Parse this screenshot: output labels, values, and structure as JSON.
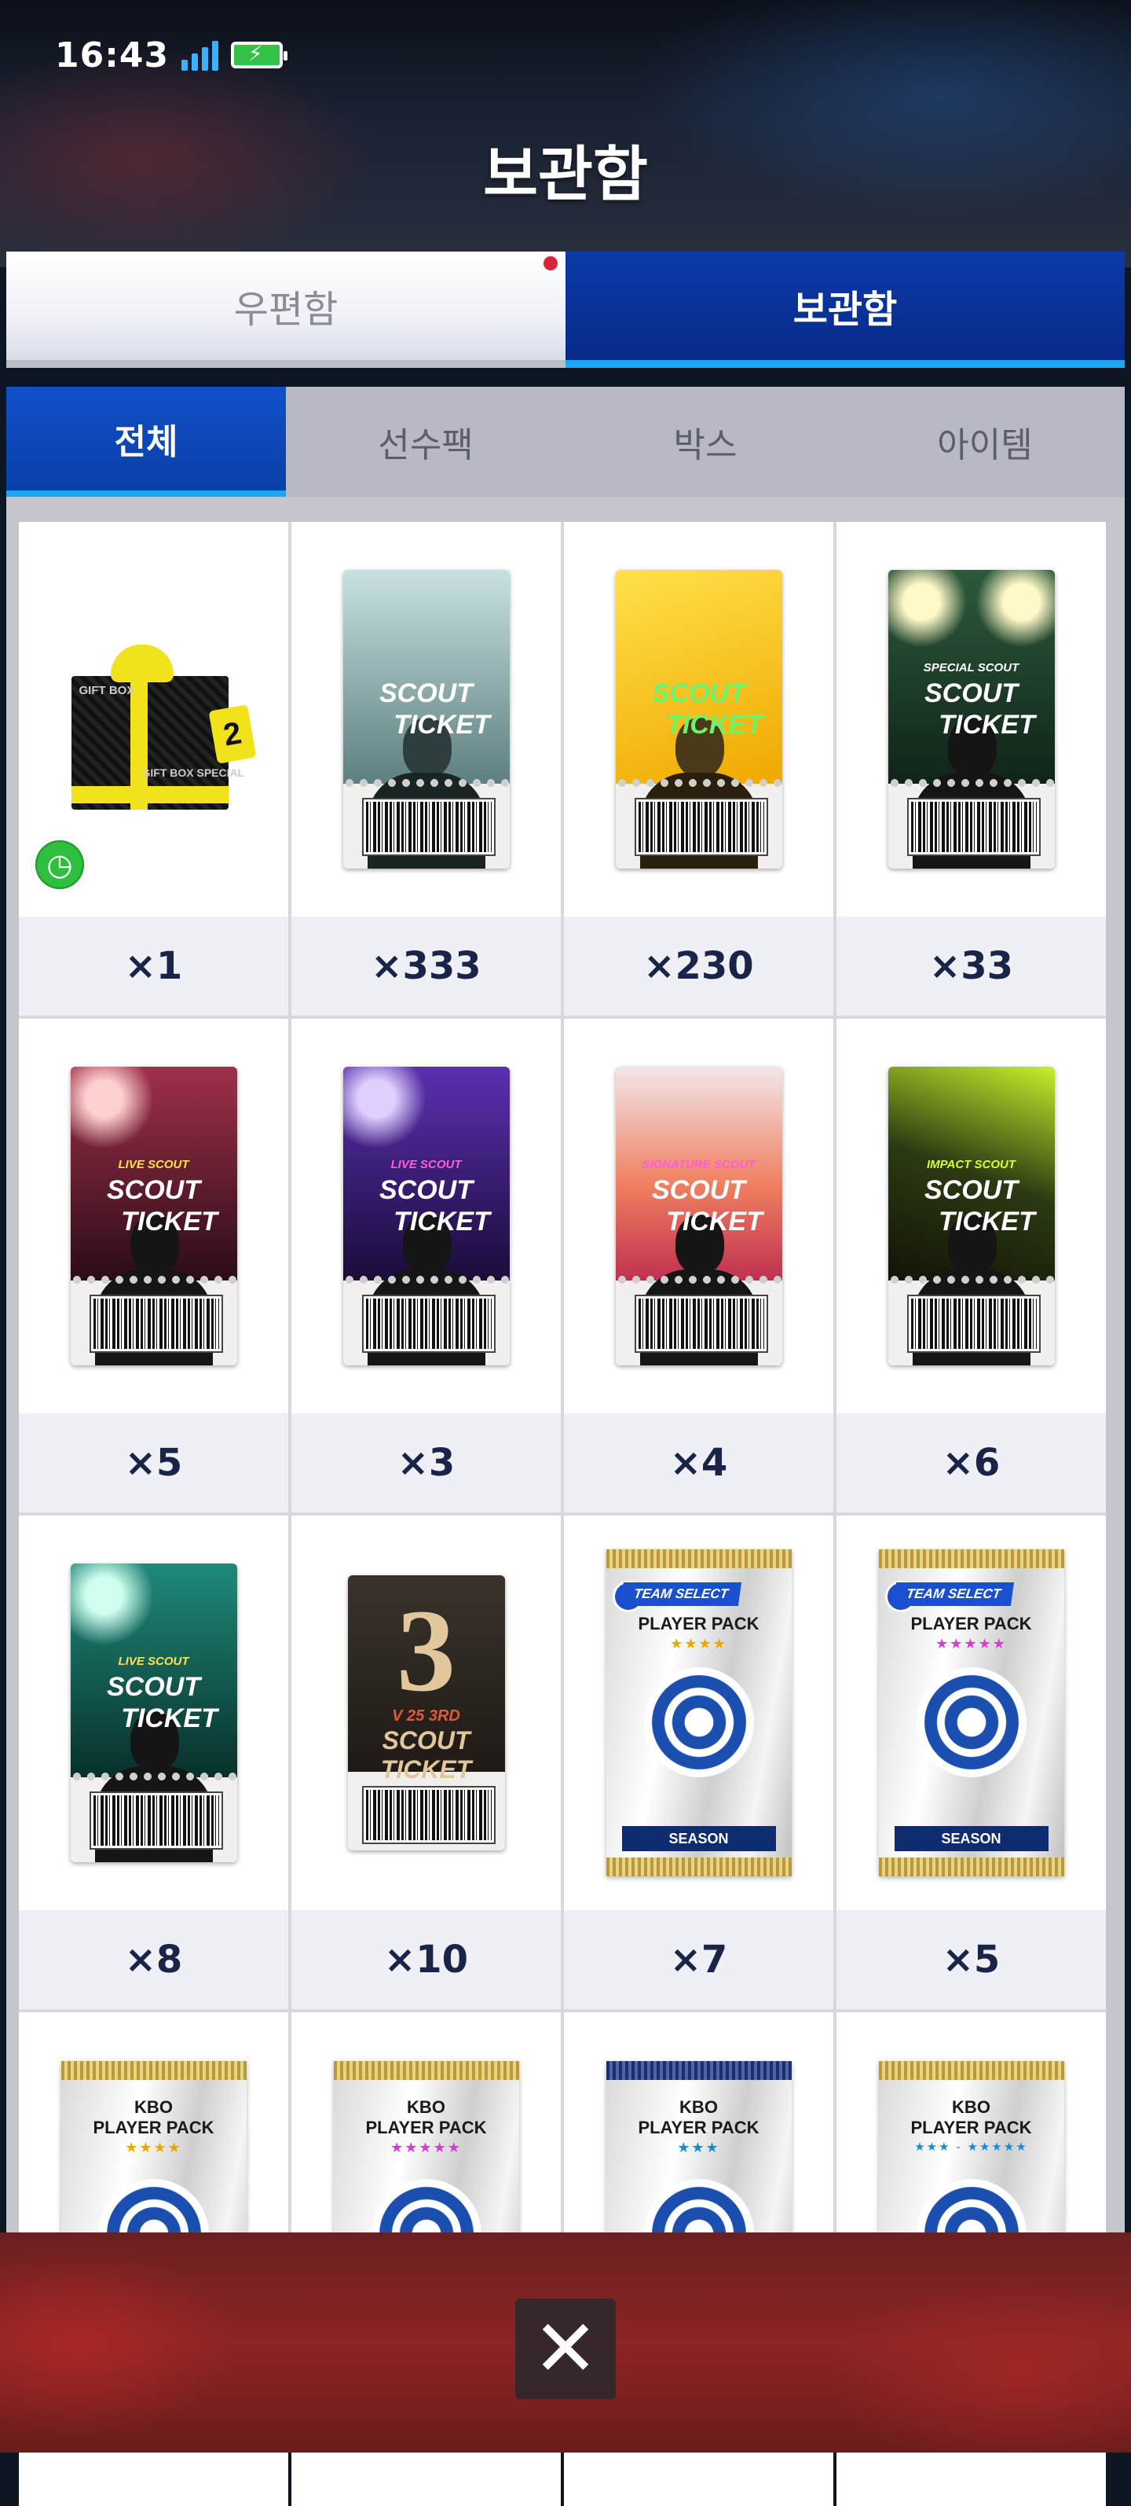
{
  "status_bar": {
    "time": "16:43"
  },
  "header": {
    "title": "보관함"
  },
  "main_tabs": [
    {
      "label": "우편함",
      "active": false,
      "has_badge": true
    },
    {
      "label": "보관함",
      "active": true
    }
  ],
  "sub_tabs": [
    {
      "label": "전체",
      "active": true
    },
    {
      "label": "선수팩"
    },
    {
      "label": "박스"
    },
    {
      "label": "아이템"
    }
  ],
  "items": [
    {
      "kind": "gift-box",
      "box_text": "GIFT BOX",
      "box_text2": "GIFT BOX SPECIAL",
      "tag": "2",
      "count": "×1"
    },
    {
      "kind": "scout-ticket",
      "line1": "SCOUT",
      "line2": "TICKET",
      "count": "×333"
    },
    {
      "kind": "scout-ticket",
      "line1": "SCOUT",
      "line2": "TICKET",
      "count": "×230"
    },
    {
      "kind": "scout-ticket",
      "sub": "SPECIAL SCOUT",
      "line1": "SCOUT",
      "line2": "TICKET",
      "count": "×33"
    },
    {
      "kind": "scout-ticket",
      "sub": "LIVE SCOUT",
      "line1": "SCOUT",
      "line2": "TICKET",
      "count": "×5"
    },
    {
      "kind": "scout-ticket",
      "sub": "LIVE SCOUT",
      "line1": "SCOUT",
      "line2": "TICKET",
      "count": "×3"
    },
    {
      "kind": "scout-ticket",
      "sub": "SIGNATURE SCOUT",
      "line1": "SCOUT",
      "line2": "TICKET",
      "count": "×4"
    },
    {
      "kind": "scout-ticket",
      "sub": "IMPACT SCOUT",
      "line1": "SCOUT",
      "line2": "TICKET",
      "count": "×6"
    },
    {
      "kind": "scout-ticket",
      "sub": "LIVE SCOUT",
      "line1": "SCOUT",
      "line2": "TICKET",
      "count": "×8"
    },
    {
      "kind": "v25-ticket",
      "big": "3",
      "label": "V 25 3RD",
      "label2": "SCOUT TICKET",
      "count": "×10"
    },
    {
      "kind": "player-pack",
      "team": "TEAM SELECT",
      "title": "PLAYER PACK",
      "stars": "★★★★",
      "season": "SEASON",
      "count": "×7"
    },
    {
      "kind": "player-pack",
      "team": "TEAM SELECT",
      "title": "PLAYER PACK",
      "stars": "★★★★★",
      "season": "SEASON",
      "count": "×5"
    },
    {
      "kind": "kbo-pack",
      "title1": "KBO",
      "title2": "PLAYER PACK",
      "stars": "★★★★",
      "count": ""
    },
    {
      "kind": "kbo-pack",
      "title1": "KBO",
      "title2": "PLAYER PACK",
      "stars": "★★★★★",
      "count": ""
    },
    {
      "kind": "kbo-pack",
      "title1": "KBO",
      "title2": "PLAYER PACK",
      "stars": "★★★",
      "count": ""
    },
    {
      "kind": "kbo-pack",
      "title1": "KBO",
      "title2": "PLAYER PACK",
      "stars": "★★★ - ★★★★★",
      "count": ""
    }
  ],
  "close_button": {
    "label": "✕"
  },
  "colors": {
    "accent_blue": "#0a3fa8",
    "accent_cyan": "#19a8f0",
    "count_text": "#1a2448"
  }
}
